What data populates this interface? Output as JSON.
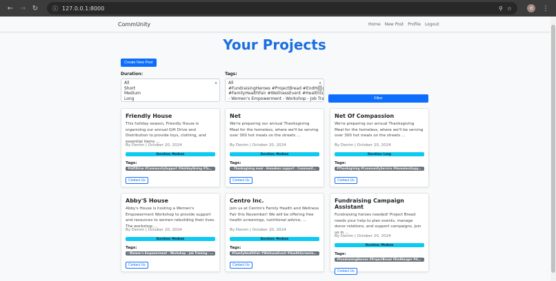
{
  "browser": {
    "url": "127.0.0.1:8000",
    "avatar": "d"
  },
  "nav": {
    "brand": "CommUnity",
    "links": [
      "Home",
      "New Post",
      "Profile",
      "Logout"
    ]
  },
  "page": {
    "title": "Your Projects",
    "create_label": "Create New Post",
    "filter_label": "Filter"
  },
  "filters": {
    "duration_label": "Duration:",
    "duration_options": [
      "All",
      "Short",
      "Medium",
      "Long"
    ],
    "tags_label": "Tags:",
    "tags_options": [
      "All",
      "#FundraisingHeroes #ProjectBread #EndHunger #Hu",
      "#FamilyHealthFair #WellnessEvent #HealthScreenings",
      "- Women's Empowerment - Workshop - Job Training"
    ]
  },
  "colors": {
    "accent": "#0d6efd",
    "title": "#1a6fe0",
    "duration_badge": "#0dcaf0",
    "tag_badge": "#6c757d"
  },
  "cards": [
    {
      "title": "Friendly House",
      "desc": "This holiday season, Friendly House is organizing our annual Gift Drive and Distribution to provide toys, clothing, and essential items ...",
      "meta": "By Denim | October 20, 2024",
      "duration": "Duration: Medium",
      "tags_label": "Tags:",
      "tags": "#GiftDrive #CommunitySupport #HolidayGiving #ToysForTot...",
      "contact": "Contact Us"
    },
    {
      "title": "Net",
      "desc": "We're preparing our annual Thanksgiving Meal for the homeless, where we'll be serving over 300 hot meals on the streets ...",
      "meta": "By Denim | October 20, 2024",
      "duration": "Duration: Medium",
      "tags_label": "Tags:",
      "tags": "- Thanksgiving meal - Homeless support - Community servic...",
      "contact": "Contact Us"
    },
    {
      "title": "Net Of Compassion",
      "desc": "We're preparing our annual Thanksgiving Meal for the homeless, where we'll be serving over 300 hot meals on the streets ...",
      "meta": "By Denim | October 20, 2024",
      "duration": "Duration: Long",
      "tags_label": "Tags:",
      "tags": "#Thanksgiving #CommunityService #HomelessSupport #Wor...",
      "contact": "Contact Us"
    },
    {
      "title": "Abby'S House",
      "desc": "Abby's House is hosting a Women's Empowerment Workshop to provide support and resources to women rebuilding their lives. The workshop ...",
      "meta": "By Denim | October 20, 2024",
      "duration": "Duration: Medium",
      "tags_label": "Tags:",
      "tags": "- Women's Empowerment - Workshop - Job Training - Financi...",
      "contact": "Contact Us"
    },
    {
      "title": "Centro Inc.",
      "desc": "Join us at Centro's Family Health and Wellness Fair this November! We will be offering free health screenings, nutritional advice, ...",
      "meta": "By Denim | October 20, 2024",
      "duration": "Duration: Medium",
      "tags_label": "Tags:",
      "tags": "#FamilyHealthFair #WellnessEvent #HealthScreenings #Nutrit...",
      "contact": "Contact Us"
    },
    {
      "title": "Fundraising Campaign Assistant",
      "desc": "Fundraising heroes needed! Project Bread needs your help to plan events, manage donor relations, and support campaigns. Join us in ...",
      "meta": "By Denim | October 20, 2024",
      "duration": "Duration: Medium",
      "tags_label": "Tags:",
      "tags": "#FundraisingHeroes #ProjectBread #EndHunger #HungerRelli...",
      "contact": "Contact Us"
    }
  ]
}
